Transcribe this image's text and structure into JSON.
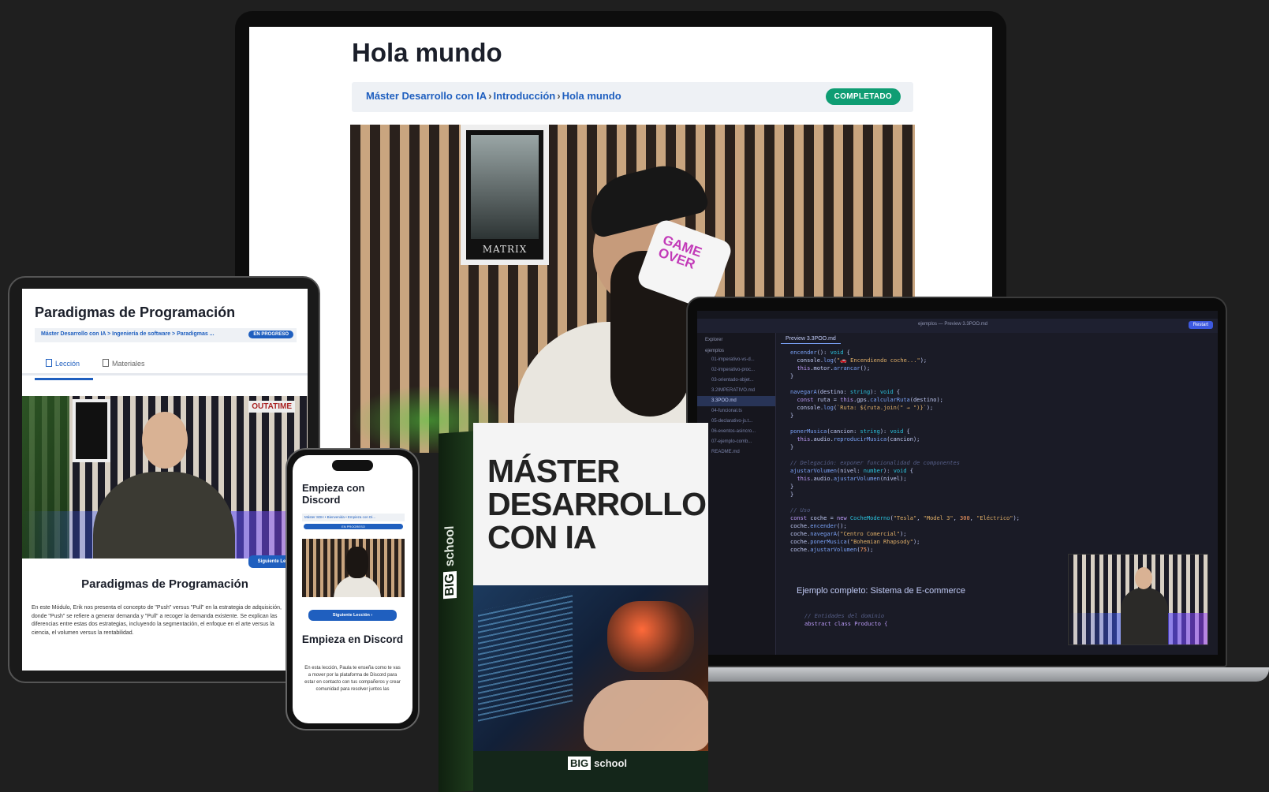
{
  "monitor": {
    "title": "Hola mundo",
    "breadcrumbs": [
      "Máster Desarrollo con IA",
      "Introducción",
      "Hola mundo"
    ],
    "status_badge": "COMPLETADO",
    "poster_text": "MATRIX",
    "mug_text": "GAME OVER"
  },
  "tablet": {
    "title": "Paradigmas de Programación",
    "breadcrumbs": "Máster Desarrollo con IA > Ingeniería de software > Paradigmas ...",
    "status_badge": "EN PROGRESO",
    "tabs": [
      "Lección",
      "Materiales"
    ],
    "sign_text": "OUTATIME",
    "next_button": "Siguiente Lección",
    "lesson_heading": "Paradigmas de Programación",
    "description": "En este Módulo, Erik nos presenta el concepto de \"Push\" versus \"Pull\" en la estrategia de adquisición, donde \"Push\" se refiere a generar demanda y \"Pull\" a recoger la demanda existente. Se explican las diferencias entre estas dos estrategias, incluyendo la segmentación, el enfoque en el arte versus la ciencia, el volumen versus la rentabilidad."
  },
  "phone": {
    "title": "Empieza con Discord",
    "breadcrumbs": "Máster SDH • Bienvenida • Empieza con Di...",
    "status_badge": "EN PROGRESO",
    "next_button": "Siguiente Lección  ›",
    "lesson_heading": "Empieza en Discord",
    "description": "En esta lección, Paula te enseña como te vas a mover por la plataforma de Discord para estar en contacto con tus compañeros y crear comunidad para resolver juntos las"
  },
  "laptop": {
    "search_text": "ejemplos — Preview 3.3POO.md",
    "run_button": "Restart",
    "explorer_label": "Explorer",
    "folder": "ejemplos",
    "files": [
      "01-imperativo-vs-d...",
      "02-imperativo-proc...",
      "03-orientado-objet...",
      "3.2IMPERATIVO.md",
      "3.3POO.md",
      "04-funcional.ts",
      "05-declarativo-js.t...",
      "06-eventos-asincro...",
      "07-ejemplo-comb...",
      "README.md"
    ],
    "selected_file": "3.3POO.md",
    "tab": "Preview 3.3POO.md",
    "section_heading": "Ejemplo completo: Sistema de E-commerce",
    "comment_entities": "// Entidades del dominio",
    "code_last": "abstract class Producto {"
  },
  "box": {
    "title_line1": "MÁSTER",
    "title_line2": "DESARROLLO",
    "title_line3": "CON IA",
    "brand_big": "BIG",
    "brand_school": "school"
  },
  "colors": {
    "brand_blue": "#1f5fbf",
    "completed_green": "#0f9d73",
    "box_green": "#14261a",
    "background": "#1f1f1f"
  }
}
